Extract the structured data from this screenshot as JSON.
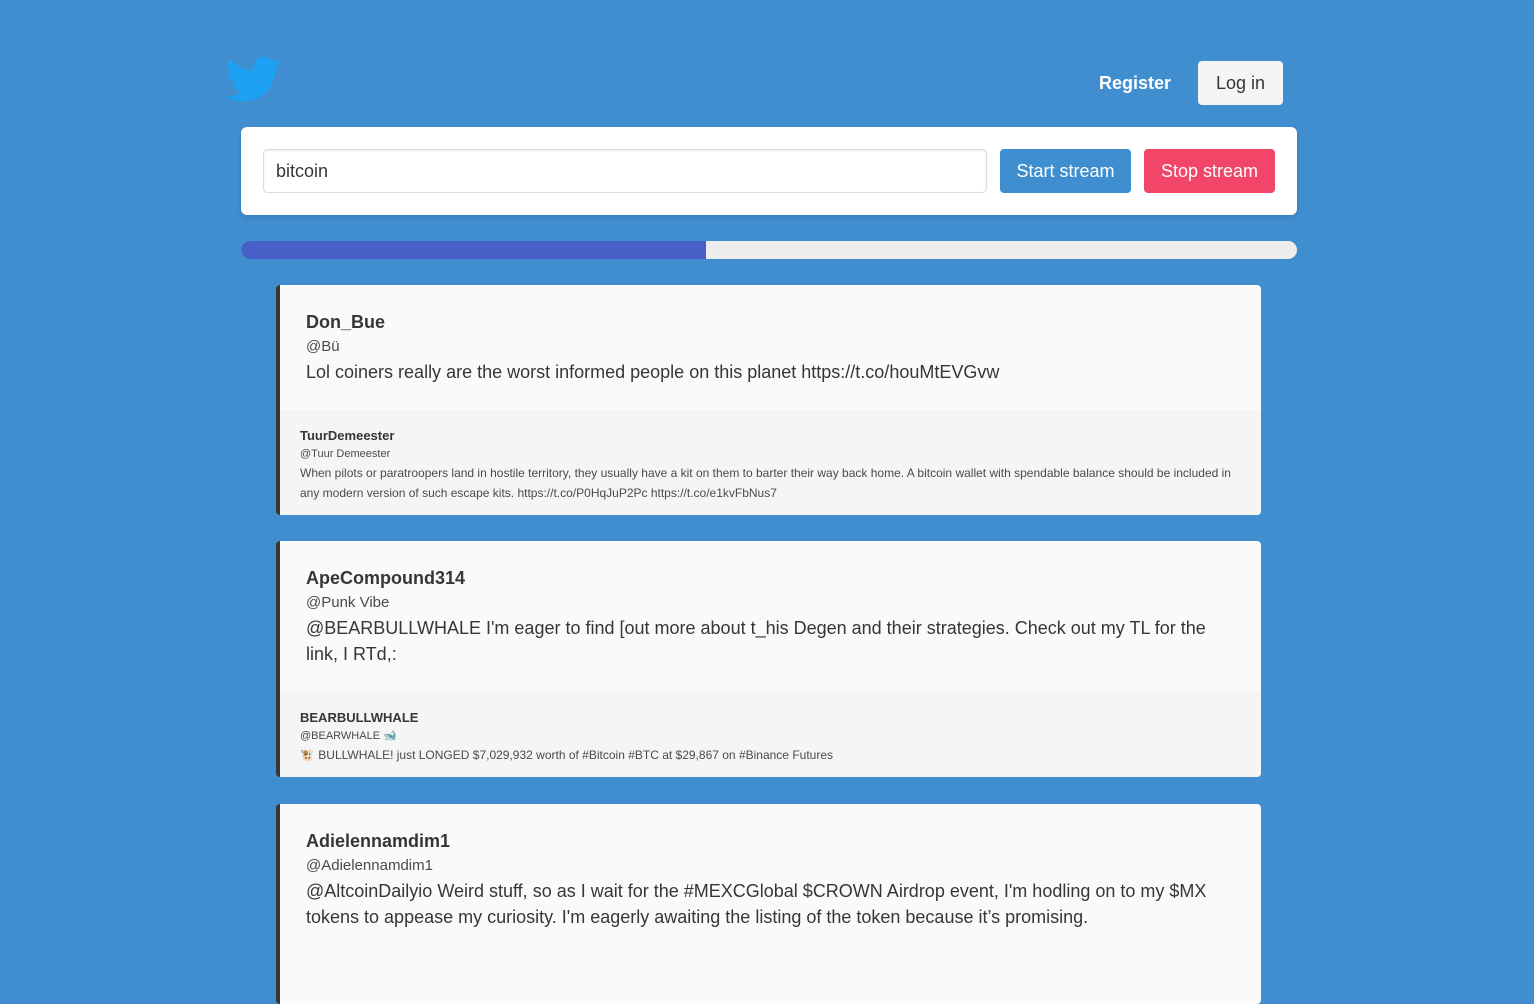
{
  "header": {
    "logo_icon": "twitter-bird-icon",
    "register_label": "Register",
    "login_label": "Log in"
  },
  "search": {
    "value": "bitcoin",
    "start_label": "Start stream",
    "stop_label": "Stop stream"
  },
  "progress": {
    "value_percent": 44
  },
  "colors": {
    "background": "#408dd0",
    "start_button": "#3e8ed0",
    "stop_button": "#f14668",
    "progress_fill": "#485fc7",
    "logo": "#1da1f2"
  },
  "tweets": [
    {
      "name": "Don_Bue",
      "handle": "@Bü",
      "text": "Lol coiners really are the worst informed people on this planet https://t.co/houMtEVGvw",
      "quote": {
        "name": "TuurDemeester",
        "handle": "@Tuur Demeester",
        "text": "When pilots or paratroopers land in hostile territory, they usually have a kit on them to barter their way back home. A bitcoin wallet with spendable balance should be included in any modern version of such escape kits. https://t.co/P0HqJuP2Pc https://t.co/e1kvFbNus7"
      }
    },
    {
      "name": "ApeCompound314",
      "handle": "@Punk Vibe",
      "text": "@BEARBULLWHALE I'm eager to find [out more about t_his Degen and their strategies. Check out my TL for the link, I RTd,:",
      "quote": {
        "name": "BEARBULLWHALE",
        "handle": "@BEARWHALE 🐋",
        "text": "🐮 BULLWHALE! just LONGED $7,029,932 worth of #Bitcoin #BTC at $29,867 on #Binance Futures"
      }
    },
    {
      "name": "Adielennamdim1",
      "handle": "@Adielennamdim1",
      "text": "@AltcoinDailyio Weird stuff, so as I wait for the #MEXCGlobal $CROWN Airdrop event, I'm hodling on to my $MX tokens to appease my curiosity. I'm eagerly awaiting the listing of the token because it’s promising."
    }
  ]
}
